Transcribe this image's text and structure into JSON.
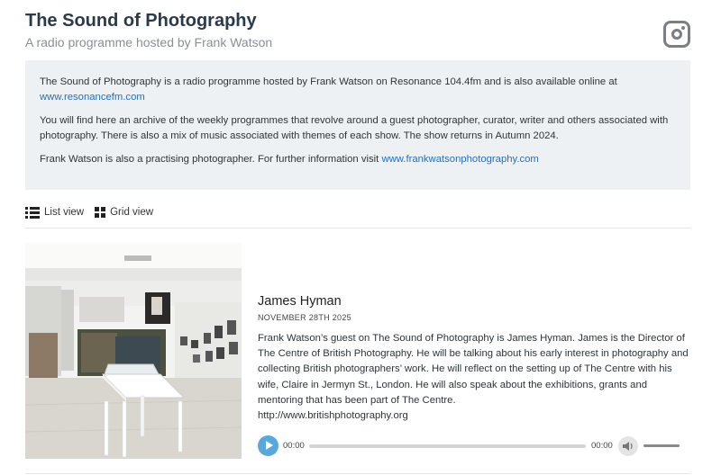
{
  "site": {
    "title": "The Sound of Photography",
    "subtitle": "A radio programme hosted by Frank Watson",
    "social_icon": "instagram-icon"
  },
  "intro": {
    "p1_text": "The Sound of Photography is a radio programme hosted by Frank Watson on Resonance 104.4fm and is also available online at",
    "p1_link": "www.resonancefm.com",
    "p2_text": "You will find here an archive of the weekly programmes that revolve around a guest photographer, curator, writer and others associated with photography. There is also a mix of music associated with themes of each show. The show returns in Autumn 2024.",
    "p3_text": "Frank Watson is also a practising photographer. For further information visit",
    "p3_link": "www.frankwatsonphotography.com"
  },
  "view_toggle": {
    "list_label": "List view",
    "grid_label": "Grid view"
  },
  "episode": {
    "title": "James Hyman",
    "date": "NOVEMBER 28TH 2025",
    "description": "Frank Watson’s guest on The Sound of Photography is James Hyman. James is the Director of The Centre of British Photography. He will be talking about his early interest in photography and collecting British photographers’ work. He will reflect on the setting up of The Centre with his wife, Claire in Jermyn St., London. He will also speak about the exhibitions, grants and mentoring that has been part of The Centre.",
    "url": "http://www.britishphotography.org",
    "player": {
      "current_time": "00:00",
      "duration": "00:00",
      "progress": 0,
      "volume": 1
    }
  },
  "colors": {
    "accent": "#5aa7dc",
    "link": "#2a6fb0",
    "intro_bg": "#edf1f4",
    "title": "#2b3a4a"
  }
}
